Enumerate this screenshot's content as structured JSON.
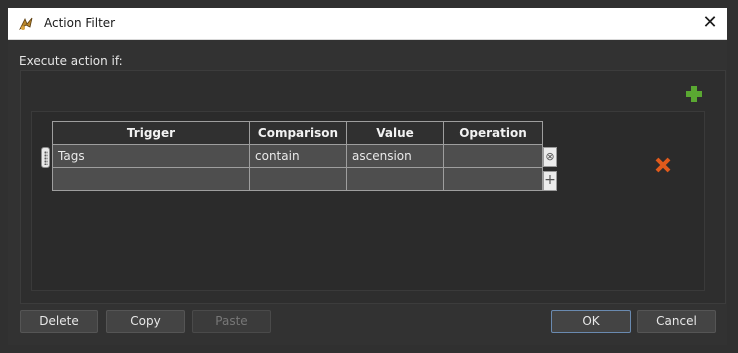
{
  "window": {
    "title": "Action Filter",
    "close_glyph": "✕"
  },
  "section": {
    "label": "Execute action if:"
  },
  "icons": {
    "app": "app-logo-icon",
    "add_rule": "green-plus-icon",
    "remove_rule": "orange-x-icon",
    "row_delete": "circle-x-icon",
    "row_add": "plus-icon",
    "drag": "drag-handle-icon"
  },
  "colors": {
    "add_green": "#5aa832",
    "remove_orange": "#e05a1c",
    "cell_bg": "#4e4e4e",
    "header_bg": "#303030"
  },
  "table": {
    "headers": [
      "Trigger",
      "Comparison",
      "Value",
      "Operation"
    ],
    "rows": [
      [
        "Tags",
        "contain",
        "ascension",
        ""
      ],
      [
        "",
        "",
        "",
        ""
      ]
    ],
    "row_delete_glyph": "⊗",
    "row_add_glyph": "+"
  },
  "buttons": {
    "delete": "Delete",
    "copy": "Copy",
    "paste": "Paste",
    "ok": "OK",
    "cancel": "Cancel"
  }
}
